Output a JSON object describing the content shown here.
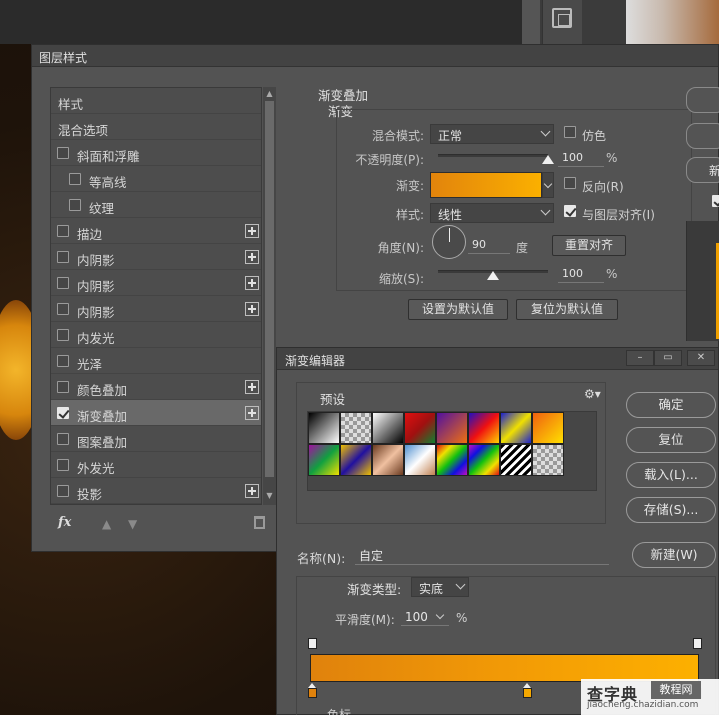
{
  "layer_style": {
    "title": "图层样式",
    "list": [
      {
        "label": "样式",
        "checkbox": false,
        "checked": false,
        "plus": false
      },
      {
        "label": "混合选项",
        "checkbox": false,
        "checked": false,
        "plus": false
      },
      {
        "label": "斜面和浮雕",
        "checkbox": true,
        "checked": false,
        "plus": false
      },
      {
        "label": "等高线",
        "checkbox": true,
        "checked": false,
        "plus": false,
        "indent": true
      },
      {
        "label": "纹理",
        "checkbox": true,
        "checked": false,
        "plus": false,
        "indent": true
      },
      {
        "label": "描边",
        "checkbox": true,
        "checked": false,
        "plus": true
      },
      {
        "label": "内阴影",
        "checkbox": true,
        "checked": false,
        "plus": true
      },
      {
        "label": "内阴影",
        "checkbox": true,
        "checked": false,
        "plus": true
      },
      {
        "label": "内阴影",
        "checkbox": true,
        "checked": false,
        "plus": true
      },
      {
        "label": "内发光",
        "checkbox": true,
        "checked": false,
        "plus": false
      },
      {
        "label": "光泽",
        "checkbox": true,
        "checked": false,
        "plus": false
      },
      {
        "label": "颜色叠加",
        "checkbox": true,
        "checked": false,
        "plus": true
      },
      {
        "label": "渐变叠加",
        "checkbox": true,
        "checked": true,
        "plus": true,
        "selected": true
      },
      {
        "label": "图案叠加",
        "checkbox": true,
        "checked": false,
        "plus": false
      },
      {
        "label": "外发光",
        "checkbox": true,
        "checked": false,
        "plus": false
      },
      {
        "label": "投影",
        "checkbox": true,
        "checked": false,
        "plus": true
      }
    ],
    "footer": {
      "fx": "fx"
    },
    "panel": {
      "group_title": "渐变叠加",
      "sub_title": "渐变",
      "blend_mode_label": "混合模式:",
      "blend_mode_value": "正常",
      "dither_label": "仿色",
      "opacity_label": "不透明度(P):",
      "opacity_value": "100",
      "opacity_unit": "%",
      "opacity_level": 1.0,
      "gradient_label": "渐变:",
      "reverse_label": "反向(R)",
      "style_label": "样式:",
      "style_value": "线性",
      "align_label": "与图层对齐(I)",
      "align_checked": true,
      "angle_label": "角度(N):",
      "angle_value": "90",
      "angle_unit": "度",
      "reset_align_label": "重置对齐",
      "scale_label": "缩放(S):",
      "scale_value": "100",
      "scale_unit": "%",
      "scale_level": 0.5,
      "set_default_label": "设置为默认值",
      "reset_default_label": "复位为默认值"
    },
    "right_buttons": {
      "new_partial": "新"
    }
  },
  "gradient_editor": {
    "title": "渐变编辑器",
    "presets_title": "预设",
    "buttons": {
      "ok": "确定",
      "reset": "复位",
      "load": "载入(L)...",
      "save": "存储(S)...",
      "new": "新建(W)"
    },
    "name_label": "名称(N):",
    "name_value": "自定",
    "type_label": "渐变类型:",
    "type_value": "实底",
    "smooth_label": "平滑度(M):",
    "smooth_value": "100",
    "smooth_unit": "%",
    "stops_label": "色标",
    "colors": {
      "start": "#e0820c",
      "end": "#fdb000"
    }
  },
  "watermark": {
    "brand": "查字典",
    "tag": "教程网",
    "url": "jiaocheng.chazidian.com"
  }
}
